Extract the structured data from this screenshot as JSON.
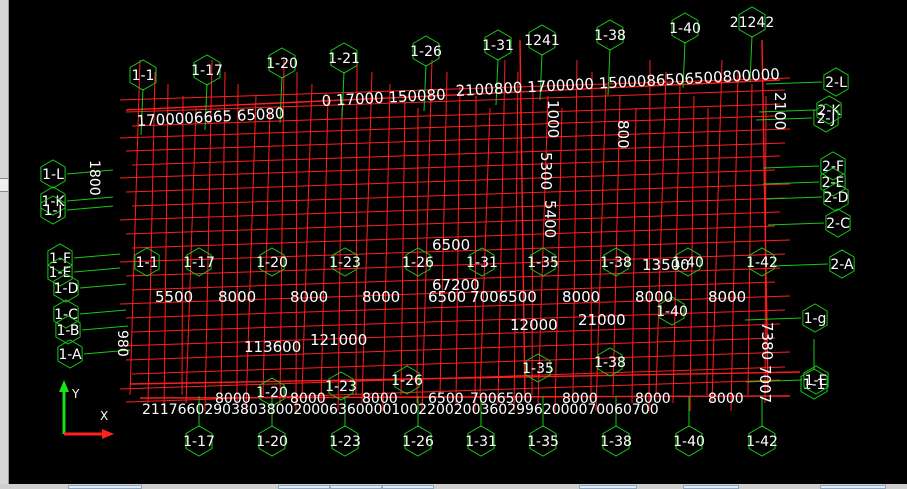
{
  "grid_lines": {
    "x": [
      "1-1",
      "1-17",
      "1-20",
      "1-21",
      "1-26",
      "1-31",
      "1241",
      "1-38",
      "1-40",
      "21242",
      "1-17",
      "1-20",
      "1-23",
      "1-26",
      "1-31",
      "1-35",
      "1-38",
      "1-40",
      "1-42",
      "1-1"
    ],
    "y": [
      "1-L",
      "1-K",
      "1-J",
      "1-F",
      "1-E",
      "1-D",
      "1-C",
      "1-B",
      "1-A",
      "2-L",
      "2-K",
      "2-J",
      "2-F",
      "2-E",
      "2-D",
      "2-C",
      "2-A",
      "1-g",
      "1-E"
    ],
    "mid": [
      "1-1",
      "1-17",
      "1-20",
      "1-23",
      "1-26",
      "1-31",
      "1-35",
      "1-38",
      "1-40",
      "1-42",
      "1-40",
      "1-35",
      "1-38",
      "1-20",
      "1-23",
      "1-26"
    ]
  },
  "dimensions": {
    "top_row": "1700006665 6508000 17000 1500800 2100800 1700000 1500086506500800000",
    "mid_row": [
      "5500",
      "8000",
      "8000",
      "8000",
      "6500",
      "7006500",
      "8000",
      "8000",
      "8000"
    ],
    "lower_row": [
      "8000",
      "8000",
      "8000",
      "6500",
      "7006500",
      "8000",
      "8000",
      "8000"
    ],
    "bottom_row": "2117660290380380020006360000100220020036029962000070060700",
    "misc": [
      "1000",
      "800",
      "2100",
      "5300",
      "5400",
      "6500",
      "67200",
      "12000",
      "21000",
      "13500",
      "113600",
      "121000",
      "1800",
      "980",
      "7380",
      "7007"
    ]
  },
  "ucs_icon": {
    "y_label": "Y",
    "x_label": "X"
  },
  "colors": {
    "grid": "#ff1e1e",
    "bubble": "#19c819",
    "text": "#ffffff",
    "axis_x": "#ff2020",
    "axis_y": "#19e019"
  }
}
